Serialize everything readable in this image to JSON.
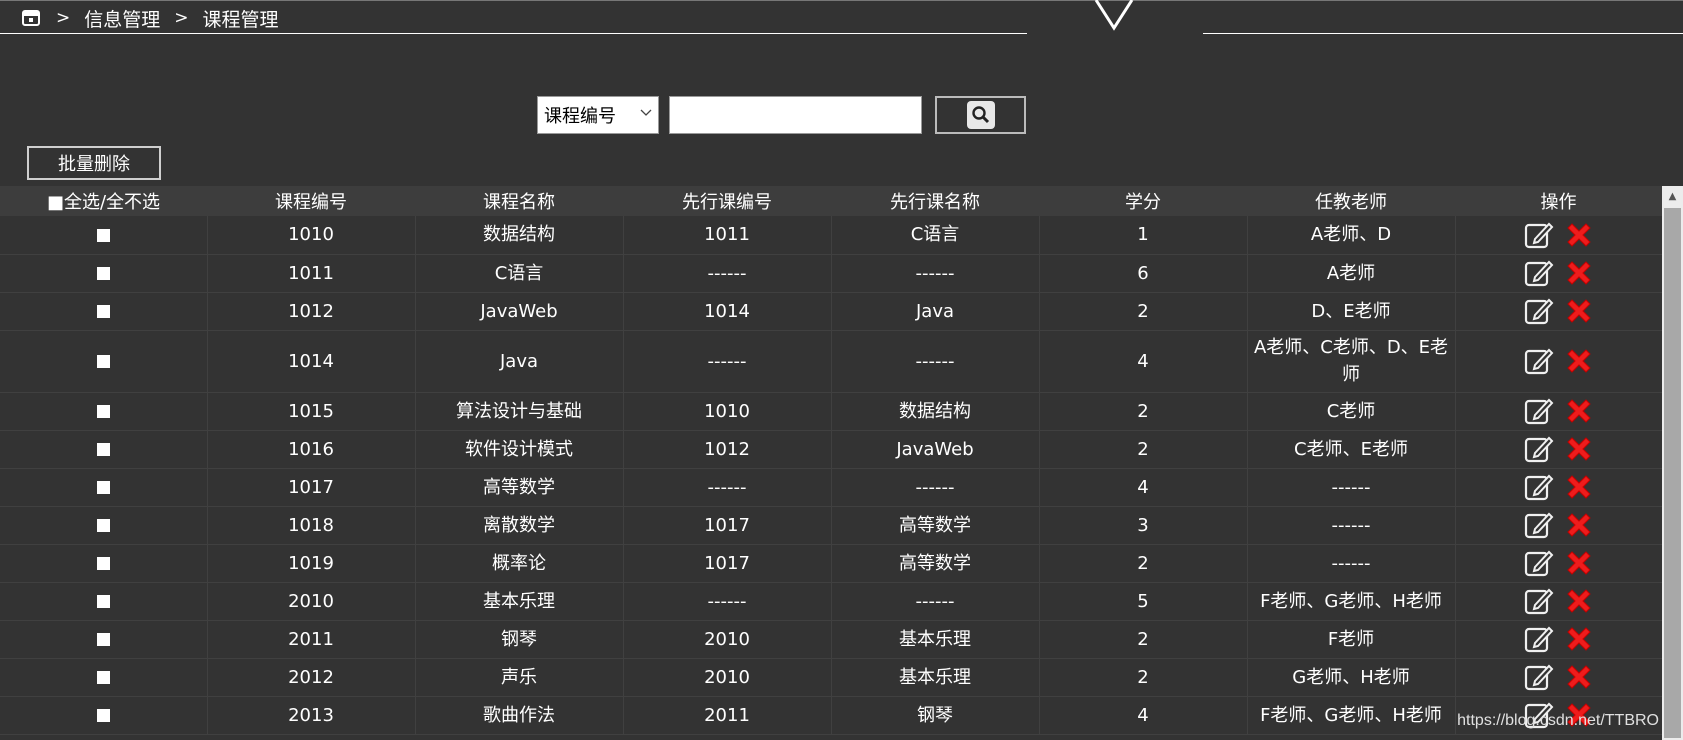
{
  "breadcrumb": {
    "sep1": ">",
    "item1": "信息管理",
    "sep2": ">",
    "item2": "课程管理"
  },
  "search": {
    "field_selected": "课程编号",
    "value": ""
  },
  "actions": {
    "batch_delete": "批量删除"
  },
  "table": {
    "headers": [
      "■全选/全不选",
      "课程编号",
      "课程名称",
      "先行课编号",
      "先行课名称",
      "学分",
      "任教老师",
      "操作"
    ],
    "rows": [
      [
        "1010",
        "数据结构",
        "1011",
        "C语言",
        "1",
        "A老师、D"
      ],
      [
        "1011",
        "C语言",
        "------",
        "------",
        "6",
        "A老师"
      ],
      [
        "1012",
        "JavaWeb",
        "1014",
        "Java",
        "2",
        "D、E老师"
      ],
      [
        "1014",
        "Java",
        "------",
        "------",
        "4",
        "A老师、C老师、D、E老师"
      ],
      [
        "1015",
        "算法设计与基础",
        "1010",
        "数据结构",
        "2",
        "C老师"
      ],
      [
        "1016",
        "软件设计模式",
        "1012",
        "JavaWeb",
        "2",
        "C老师、E老师"
      ],
      [
        "1017",
        "高等数学",
        "------",
        "------",
        "4",
        "------"
      ],
      [
        "1018",
        "离散数学",
        "1017",
        "高等数学",
        "3",
        "------"
      ],
      [
        "1019",
        "概率论",
        "1017",
        "高等数学",
        "2",
        "------"
      ],
      [
        "2010",
        "基本乐理",
        "------",
        "------",
        "5",
        "F老师、G老师、H老师"
      ],
      [
        "2011",
        "钢琴",
        "2010",
        "基本乐理",
        "2",
        "F老师"
      ],
      [
        "2012",
        "声乐",
        "2010",
        "基本乐理",
        "2",
        "G老师、H老师"
      ],
      [
        "2013",
        "歌曲作法",
        "2011",
        "钢琴",
        "4",
        "F老师、G老师、H老师"
      ]
    ]
  },
  "watermark": "https://blog.csdn.net/TTBRO"
}
